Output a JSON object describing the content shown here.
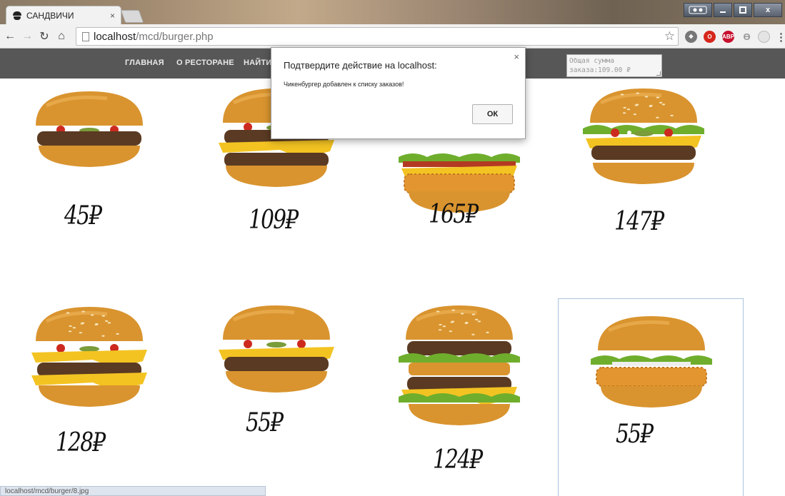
{
  "browser": {
    "tab_title": "САНДВИЧИ",
    "tab_close": "×",
    "url_host": "localhost",
    "url_path": "/mcd/burger.php",
    "window_close": "x",
    "status_url": "localhost/mcd/burger/8.jpg",
    "extensions": [
      "puzzle-icon",
      "opera-icon",
      "adblock-icon",
      "feather-icon",
      "circle-icon"
    ]
  },
  "site": {
    "nav": [
      "ГЛАВНАЯ",
      "О РЕСТОРАНЕ",
      "НАЙТИ"
    ],
    "order_total": "Общая сумма заказа:109.00 ₽"
  },
  "dialog": {
    "title": "Подтвердите действие на localhost:",
    "close": "×",
    "message": "Чикенбургер добавлен к списку заказов!",
    "ok_label": "ОК"
  },
  "products": [
    {
      "price": "45₽",
      "image": "hamburger"
    },
    {
      "price": "109₽",
      "image": "double-cheeseburger"
    },
    {
      "price": "165₽",
      "image": "chicken-bacon-burger"
    },
    {
      "price": "147₽",
      "image": "big-tasty"
    },
    {
      "price": "128₽",
      "image": "double-cheese-burger"
    },
    {
      "price": "55₽",
      "image": "cheeseburger"
    },
    {
      "price": "124₽",
      "image": "big-mac"
    },
    {
      "price": "55₽",
      "image": "chickenburger"
    }
  ],
  "colors": {
    "nav_bg": "#575757",
    "bun": "#d9942f",
    "patty": "#5a3a22",
    "cheese": "#f3c322",
    "lettuce": "#6fae2d",
    "tomato": "#cc2a1e"
  }
}
